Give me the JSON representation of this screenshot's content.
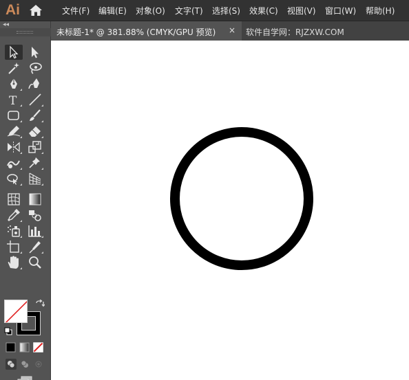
{
  "app": {
    "logo": "Ai"
  },
  "menu": {
    "items": [
      {
        "label": "文件(F)"
      },
      {
        "label": "编辑(E)"
      },
      {
        "label": "对象(O)"
      },
      {
        "label": "文字(T)"
      },
      {
        "label": "选择(S)"
      },
      {
        "label": "效果(C)"
      },
      {
        "label": "视图(V)"
      },
      {
        "label": "窗口(W)"
      },
      {
        "label": "帮助(H)"
      }
    ]
  },
  "toolbar": {
    "collapse_glyph": "◂◂",
    "tools": [
      {
        "name": "selection-tool",
        "icon": "arrow-hollow-icon",
        "selected": true
      },
      {
        "name": "direct-selection-tool",
        "icon": "arrow-filled-icon"
      },
      {
        "name": "magic-wand-tool",
        "icon": "magic-wand-icon"
      },
      {
        "name": "lasso-tool",
        "icon": "lasso-icon"
      },
      {
        "name": "pen-tool",
        "icon": "pen-icon"
      },
      {
        "name": "curvature-tool",
        "icon": "curvature-pen-icon"
      },
      {
        "name": "type-tool",
        "icon": "type-icon"
      },
      {
        "name": "line-segment-tool",
        "icon": "line-icon"
      },
      {
        "name": "rectangle-tool",
        "icon": "rounded-rect-icon"
      },
      {
        "name": "paintbrush-tool",
        "icon": "brush-icon"
      },
      {
        "name": "shaper-tool",
        "icon": "pencil-icon"
      },
      {
        "name": "eraser-tool",
        "icon": "eraser-icon"
      },
      {
        "name": "reflect-tool",
        "icon": "reflect-icon"
      },
      {
        "name": "scale-tool",
        "icon": "scale-icon"
      },
      {
        "name": "warp-tool",
        "icon": "warp-icon"
      },
      {
        "name": "puppet-warp-tool",
        "icon": "pin-icon"
      },
      {
        "name": "shape-builder-tool",
        "icon": "shape-builder-icon"
      },
      {
        "name": "perspective-grid-tool",
        "icon": "perspective-grid-icon"
      },
      {
        "name": "mesh-tool",
        "icon": "mesh-icon"
      },
      {
        "name": "gradient-tool",
        "icon": "gradient-icon"
      },
      {
        "name": "eyedropper-tool",
        "icon": "eyedropper-icon"
      },
      {
        "name": "blend-tool",
        "icon": "blend-icon"
      },
      {
        "name": "symbol-sprayer-tool",
        "icon": "symbol-sprayer-icon"
      },
      {
        "name": "column-graph-tool",
        "icon": "column-graph-icon"
      },
      {
        "name": "artboard-tool",
        "icon": "artboard-icon"
      },
      {
        "name": "slice-tool",
        "icon": "slice-icon"
      },
      {
        "name": "hand-tool",
        "icon": "hand-icon"
      },
      {
        "name": "zoom-tool",
        "icon": "zoom-icon"
      }
    ],
    "fill_color": "#ffffff",
    "stroke_color": "#000000",
    "none_slash_color": "#e02020"
  },
  "tabs": [
    {
      "label": "未标题-1* @ 381.88% (CMYK/GPU 预览)",
      "active": true,
      "close_glyph": "×"
    },
    {
      "label": "软件自学网：RJZXW.COM",
      "active": false
    }
  ],
  "canvas": {
    "background": "#ffffff",
    "shape": {
      "type": "circle",
      "fill": "#ffffff",
      "stroke": "#000000"
    }
  },
  "colors": {
    "menubar_bg": "#323232",
    "panel_bg": "#535353",
    "logo": "#cc8a5a"
  }
}
